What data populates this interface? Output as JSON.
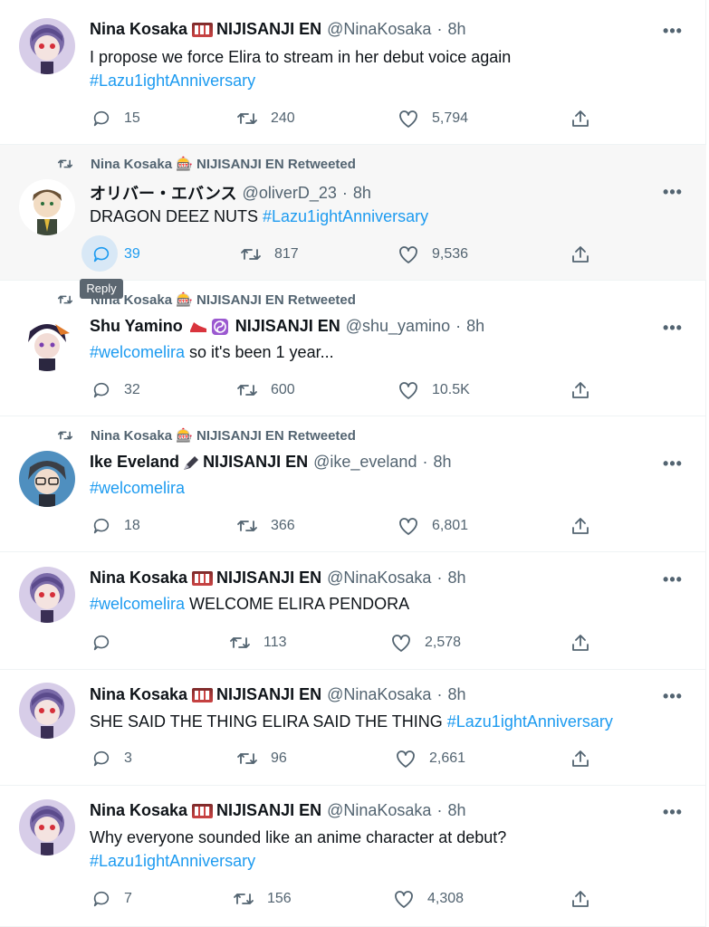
{
  "colors": {
    "link": "#1d9bf0",
    "muted": "#536471",
    "text": "#0f1419",
    "hover_bg": "#f7f7f7"
  },
  "tooltip": "Reply",
  "tweets": [
    {
      "retweet_by": "",
      "name": "Nina Kosaka",
      "badge_icon": "slot-machine-icon",
      "suffix": "NIJISANJI EN",
      "handle": "@NinaKosaka",
      "dot": "·",
      "time": "8h",
      "text_before": "I propose we force Elira to stream in her debut voice again",
      "hashtag": "#Lazu1ightAnniversary",
      "text_after": "",
      "replies": "15",
      "retweets": "240",
      "likes": "5,794"
    },
    {
      "retweet_by": "Nina Kosaka 🎰 NIJISANJI EN Retweeted",
      "name": "オリバー・エバンス",
      "badge_icon": "",
      "suffix": "",
      "handle": "@oliverD_23",
      "dot": "·",
      "time": "8h",
      "text_before": "DRAGON DEEZ NUTS ",
      "hashtag": "#Lazu1ightAnniversary",
      "text_after": "",
      "replies": "39",
      "retweets": "817",
      "likes": "9,536"
    },
    {
      "retweet_by": "Nina Kosaka 🎰 NIJISANJI EN Retweeted",
      "name": "Shu Yamino",
      "badge_icon": "shoe-and-yin-yang-icon",
      "suffix": "NIJISANJI EN",
      "handle": "@shu_yamino",
      "dot": "·",
      "time": "8h",
      "text_before": "",
      "hashtag": "#welcomelira",
      "text_after": " so it's been 1 year...",
      "replies": "32",
      "retweets": "600",
      "likes": "10.5K"
    },
    {
      "retweet_by": "Nina Kosaka 🎰 NIJISANJI EN Retweeted",
      "name": "Ike Eveland",
      "badge_icon": "fountain-pen-icon",
      "suffix": "NIJISANJI EN",
      "handle": "@ike_eveland",
      "dot": "·",
      "time": "8h",
      "text_before": "",
      "hashtag": "#welcomelira",
      "text_after": "",
      "replies": "18",
      "retweets": "366",
      "likes": "6,801"
    },
    {
      "retweet_by": "",
      "name": "Nina Kosaka",
      "badge_icon": "slot-machine-icon",
      "suffix": "NIJISANJI EN",
      "handle": "@NinaKosaka",
      "dot": "·",
      "time": "8h",
      "text_before": "",
      "hashtag": "#welcomelira",
      "text_after": " WELCOME ELIRA PENDORA",
      "replies": "",
      "retweets": "113",
      "likes": "2,578"
    },
    {
      "retweet_by": "",
      "name": "Nina Kosaka",
      "badge_icon": "slot-machine-icon",
      "suffix": "NIJISANJI EN",
      "handle": "@NinaKosaka",
      "dot": "·",
      "time": "8h",
      "text_before": "SHE SAID THE THING ELIRA SAID THE THING ",
      "hashtag": "#Lazu1ightAnniversary",
      "text_after": "",
      "replies": "3",
      "retweets": "96",
      "likes": "2,661"
    },
    {
      "retweet_by": "",
      "name": "Nina Kosaka",
      "badge_icon": "slot-machine-icon",
      "suffix": "NIJISANJI EN",
      "handle": "@NinaKosaka",
      "dot": "·",
      "time": "8h",
      "text_before": "Why everyone sounded like an anime character at debut?",
      "hashtag": "#Lazu1ightAnniversary",
      "text_after": "",
      "replies": "7",
      "retweets": "156",
      "likes": "4,308"
    }
  ]
}
